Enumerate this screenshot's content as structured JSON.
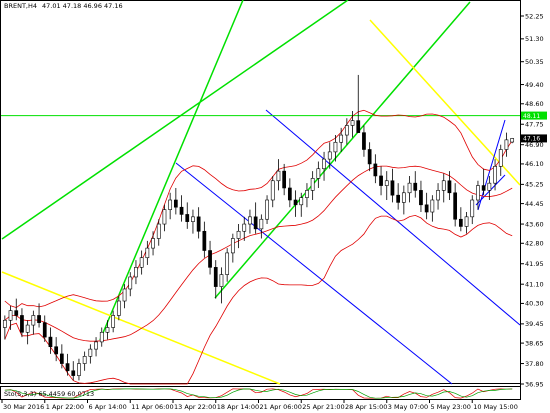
{
  "header": {
    "symbol": "BRENT,H4",
    "ohlc": "47.01 47.18 46.96 47.16"
  },
  "indicator": {
    "label": "Sto(5,3,3) 65.4459 60.0713"
  },
  "colors": {
    "background": "#ffffff",
    "candle_up": "#000000",
    "candle_down": "#000000",
    "band": "#e00000",
    "green_line": "#00e000",
    "yellow_line": "#ffff00",
    "blue_line": "#0000ff",
    "stoch_main": "#e00000",
    "stoch_signal": "#00a000"
  },
  "chart_data": {
    "type": "candlestick",
    "x_tick_labels": [
      "30 Mar 2016",
      "1 Apr 22:00",
      "6 Apr 14:00",
      "11 Apr 06:00",
      "13 Apr 22:00",
      "18 Apr 14:00",
      "21 Apr 06:00",
      "25 Apr 21:00",
      "28 Apr 15:00",
      "3 May 07:00",
      "5 May 23:00",
      "10 May 15:00"
    ],
    "y_tick_labels": [
      "52.25",
      "51.30",
      "50.35",
      "49.40",
      "48.60",
      "47.75",
      "46.90",
      "46.10",
      "45.25",
      "44.45",
      "43.60",
      "42.80",
      "41.95",
      "41.10",
      "40.30",
      "39.45",
      "38.65",
      "37.80",
      "36.95"
    ],
    "ylim": [
      36.95,
      52.25
    ],
    "horizontal_line": {
      "value": 48.11,
      "label": "48.11"
    },
    "current_price": {
      "value": 47.16,
      "label": "47.16"
    },
    "candles": [
      [
        39.3,
        39.8,
        38.8,
        39.6
      ],
      [
        39.6,
        40.2,
        39.2,
        40.0
      ],
      [
        40.0,
        40.5,
        39.6,
        39.8
      ],
      [
        39.8,
        40.1,
        38.9,
        39.1
      ],
      [
        39.1,
        39.6,
        38.6,
        39.4
      ],
      [
        39.4,
        40.0,
        39.0,
        39.8
      ],
      [
        39.8,
        40.3,
        39.3,
        39.5
      ],
      [
        39.5,
        39.8,
        38.7,
        38.9
      ],
      [
        38.9,
        39.3,
        38.2,
        38.5
      ],
      [
        38.5,
        38.9,
        37.9,
        38.2
      ],
      [
        38.2,
        38.6,
        37.6,
        37.8
      ],
      [
        37.8,
        38.2,
        37.3,
        37.5
      ],
      [
        37.5,
        37.9,
        37.1,
        37.3
      ],
      [
        37.3,
        38.0,
        37.1,
        37.8
      ],
      [
        37.8,
        38.3,
        37.5,
        38.1
      ],
      [
        38.1,
        38.6,
        37.8,
        38.4
      ],
      [
        38.4,
        38.9,
        38.1,
        38.7
      ],
      [
        38.7,
        39.3,
        38.5,
        39.1
      ],
      [
        39.1,
        39.6,
        38.8,
        39.3
      ],
      [
        39.3,
        40.0,
        39.1,
        39.8
      ],
      [
        39.8,
        40.6,
        39.6,
        40.4
      ],
      [
        40.4,
        41.1,
        40.1,
        40.9
      ],
      [
        40.9,
        41.6,
        40.6,
        41.4
      ],
      [
        41.4,
        42.1,
        41.1,
        41.8
      ],
      [
        41.8,
        42.5,
        41.5,
        42.2
      ],
      [
        42.2,
        42.9,
        41.9,
        42.6
      ],
      [
        42.6,
        43.3,
        42.3,
        43.0
      ],
      [
        43.0,
        43.8,
        42.7,
        43.6
      ],
      [
        43.6,
        44.4,
        43.3,
        44.2
      ],
      [
        44.2,
        44.9,
        43.8,
        44.6
      ],
      [
        44.6,
        45.1,
        44.0,
        44.3
      ],
      [
        44.3,
        44.8,
        43.7,
        44.0
      ],
      [
        44.0,
        44.5,
        43.4,
        43.7
      ],
      [
        43.7,
        44.2,
        43.2,
        43.9
      ],
      [
        43.9,
        44.3,
        43.0,
        43.3
      ],
      [
        43.3,
        43.7,
        42.2,
        42.5
      ],
      [
        42.5,
        42.9,
        41.5,
        41.8
      ],
      [
        41.8,
        42.1,
        40.5,
        41.0
      ],
      [
        41.0,
        41.8,
        40.3,
        41.5
      ],
      [
        41.5,
        42.6,
        41.2,
        42.4
      ],
      [
        42.4,
        43.2,
        42.0,
        43.0
      ],
      [
        43.0,
        43.6,
        42.6,
        43.3
      ],
      [
        43.3,
        43.9,
        42.9,
        43.6
      ],
      [
        43.6,
        44.2,
        43.2,
        43.9
      ],
      [
        43.9,
        44.5,
        43.2,
        43.4
      ],
      [
        43.4,
        44.0,
        43.0,
        43.8
      ],
      [
        43.8,
        44.8,
        43.6,
        44.6
      ],
      [
        44.6,
        45.6,
        44.3,
        45.4
      ],
      [
        45.4,
        46.3,
        45.0,
        45.8
      ],
      [
        45.8,
        46.1,
        44.8,
        45.1
      ],
      [
        45.1,
        45.5,
        44.3,
        44.6
      ],
      [
        44.6,
        45.0,
        43.9,
        44.4
      ],
      [
        44.4,
        44.9,
        43.9,
        44.7
      ],
      [
        44.7,
        45.3,
        44.3,
        45.0
      ],
      [
        45.0,
        45.8,
        44.6,
        45.5
      ],
      [
        45.5,
        46.2,
        45.1,
        45.9
      ],
      [
        45.9,
        46.6,
        45.4,
        46.3
      ],
      [
        46.3,
        47.0,
        45.9,
        46.6
      ],
      [
        46.6,
        47.3,
        46.2,
        47.0
      ],
      [
        47.0,
        47.6,
        46.6,
        47.3
      ],
      [
        47.3,
        48.0,
        46.9,
        47.7
      ],
      [
        47.7,
        48.3,
        47.2,
        47.9
      ],
      [
        47.9,
        49.8,
        47.5,
        47.4
      ],
      [
        47.4,
        47.7,
        46.4,
        46.7
      ],
      [
        46.7,
        47.0,
        45.8,
        46.1
      ],
      [
        46.1,
        46.5,
        45.3,
        45.6
      ],
      [
        45.6,
        46.0,
        44.8,
        45.2
      ],
      [
        45.2,
        45.8,
        44.6,
        45.4
      ],
      [
        45.4,
        45.9,
        44.5,
        44.8
      ],
      [
        44.8,
        45.3,
        44.2,
        44.5
      ],
      [
        44.5,
        45.2,
        44.0,
        44.9
      ],
      [
        44.9,
        45.6,
        44.5,
        45.3
      ],
      [
        45.3,
        45.8,
        44.7,
        45.0
      ],
      [
        45.0,
        45.4,
        44.1,
        44.4
      ],
      [
        44.4,
        44.9,
        43.8,
        44.1
      ],
      [
        44.1,
        44.8,
        43.7,
        44.6
      ],
      [
        44.6,
        45.3,
        44.2,
        45.0
      ],
      [
        45.0,
        45.7,
        44.5,
        45.4
      ],
      [
        45.4,
        45.8,
        44.6,
        44.9
      ],
      [
        44.9,
        45.3,
        43.5,
        43.8
      ],
      [
        43.8,
        44.3,
        43.3,
        43.5
      ],
      [
        43.5,
        44.1,
        43.2,
        43.9
      ],
      [
        43.9,
        44.8,
        43.6,
        44.6
      ],
      [
        44.6,
        45.4,
        44.2,
        45.2
      ],
      [
        45.2,
        45.9,
        44.8,
        45.0
      ],
      [
        45.0,
        45.6,
        44.6,
        45.3
      ],
      [
        45.3,
        46.3,
        45.0,
        46.0
      ],
      [
        46.0,
        46.9,
        45.6,
        46.7
      ],
      [
        46.7,
        47.4,
        46.4,
        47.1
      ],
      [
        47.01,
        47.18,
        46.96,
        47.16
      ]
    ]
  }
}
